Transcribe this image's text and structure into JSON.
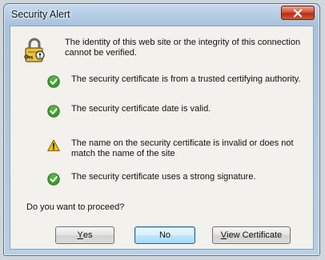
{
  "window": {
    "title": "Security Alert",
    "close_icon": "close-icon"
  },
  "header": {
    "icon": "lock-key-icon",
    "text": "The identity of this web site or the integrity of this connection cannot be verified."
  },
  "checks": [
    {
      "status": "ok",
      "icon": "green-check-icon",
      "text": "The security certificate is from a trusted certifying authority."
    },
    {
      "status": "ok",
      "icon": "green-check-icon",
      "text": "The security certificate date is valid."
    },
    {
      "status": "warning",
      "icon": "warning-icon",
      "text": "The name on the security certificate is invalid or does not match the name of the site"
    },
    {
      "status": "ok",
      "icon": "green-check-icon",
      "text": "The security certificate uses a strong signature."
    }
  ],
  "question": "Do you want to proceed?",
  "buttons": {
    "yes": {
      "first": "Y",
      "rest": "es"
    },
    "no": {
      "label": "No"
    },
    "view_certificate": {
      "first": "V",
      "rest": "iew Certificate"
    }
  },
  "colors": {
    "ok": "#3a9a2c",
    "warning": "#f2c200",
    "close_button": "#c7432a"
  }
}
